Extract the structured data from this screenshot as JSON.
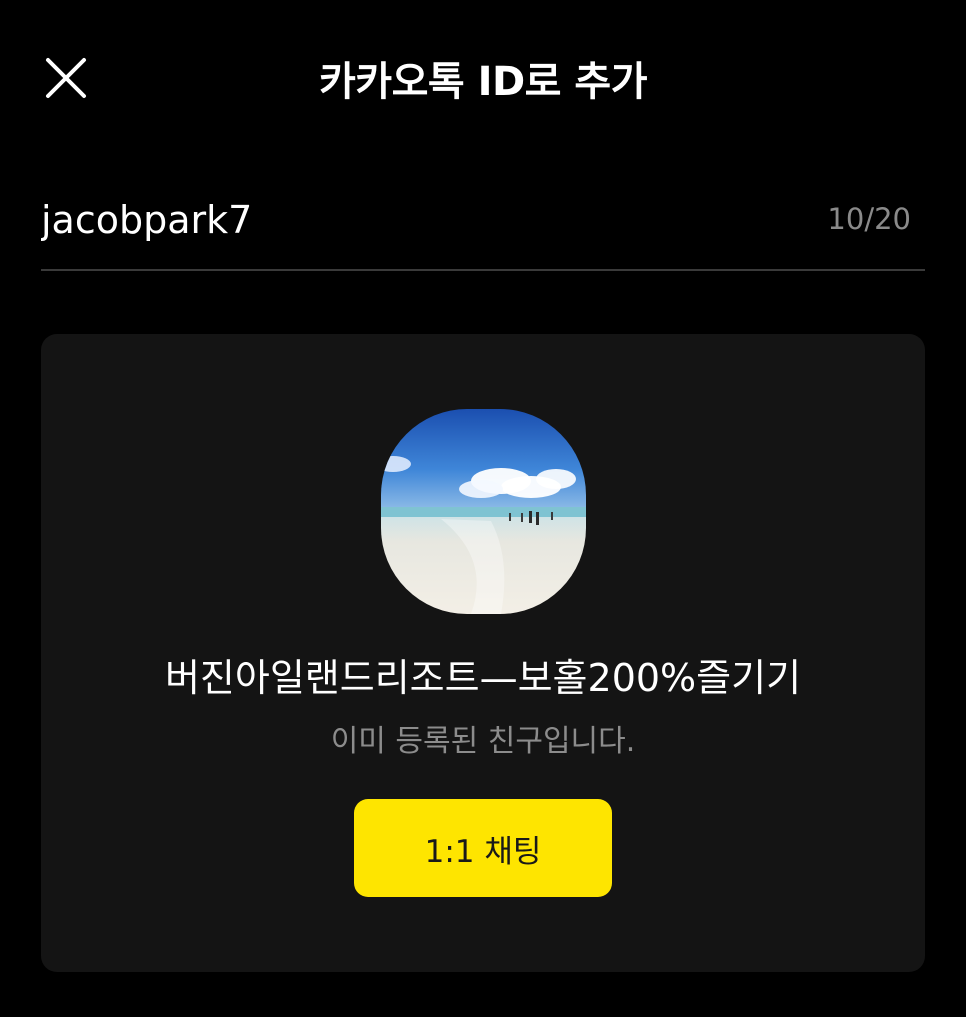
{
  "header": {
    "title": "카카오톡 ID로 추가",
    "close_icon": "close-icon"
  },
  "search": {
    "value": "jacobpark7",
    "char_count": "10/20"
  },
  "result": {
    "avatar_icon": "profile-photo-beach",
    "name": "버진아일랜드리조트—보홀200%즐기기",
    "status": "이미 등록된 친구입니다.",
    "chat_button_label": "1:1 채팅"
  },
  "colors": {
    "background": "#000000",
    "card": "#141414",
    "accent": "#fee500",
    "muted_text": "#8c8c8c"
  }
}
